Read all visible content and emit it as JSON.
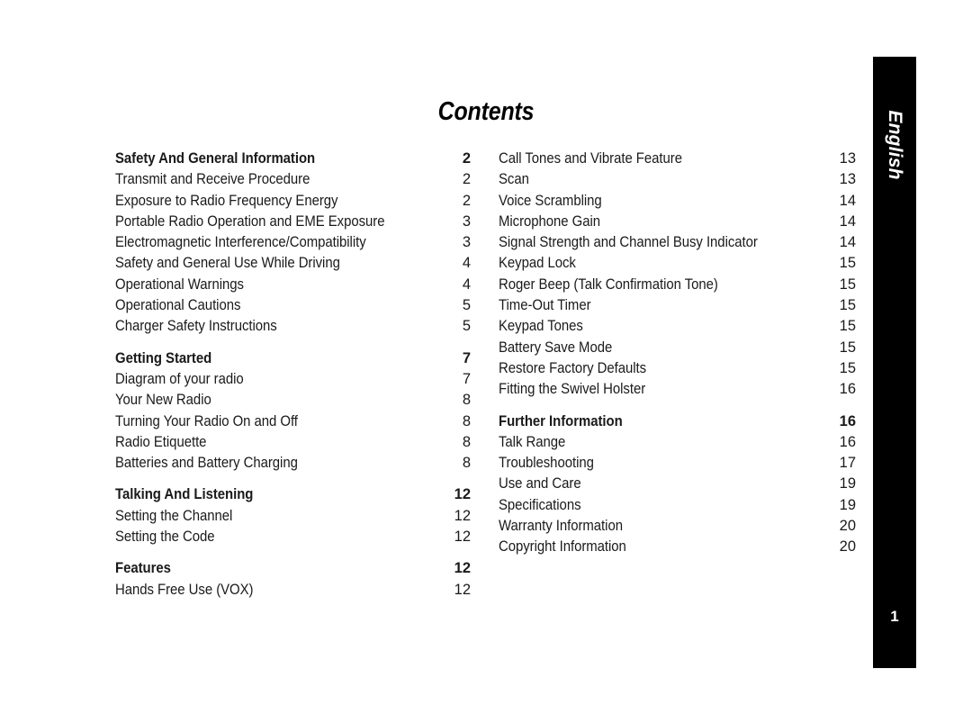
{
  "page": {
    "title": "Contents",
    "number": "1",
    "language_tab": "English"
  },
  "toc": {
    "left_column": [
      {
        "label": "Safety And General Information",
        "page": "2",
        "type": "section"
      },
      {
        "label": "Transmit and Receive Procedure",
        "page": "2",
        "type": "entry"
      },
      {
        "label": "Exposure to Radio Frequency Energy",
        "page": "2",
        "type": "entry"
      },
      {
        "label": "Portable Radio Operation and EME Exposure",
        "page": "3",
        "type": "entry"
      },
      {
        "label": "Electromagnetic Interference/Compatibility",
        "page": "3",
        "type": "entry"
      },
      {
        "label": "Safety and General Use While Driving",
        "page": "4",
        "type": "entry"
      },
      {
        "label": "Operational Warnings",
        "page": "4",
        "type": "entry"
      },
      {
        "label": "Operational Cautions",
        "page": "5",
        "type": "entry"
      },
      {
        "label": "Charger Safety Instructions",
        "page": "5",
        "type": "entry"
      },
      {
        "label": "",
        "page": "",
        "type": "spacer"
      },
      {
        "label": "Getting Started",
        "page": "7",
        "type": "section"
      },
      {
        "label": "Diagram of your radio",
        "page": "7",
        "type": "entry"
      },
      {
        "label": "Your New Radio",
        "page": "8",
        "type": "entry"
      },
      {
        "label": "Turning Your Radio On and Off",
        "page": "8",
        "type": "entry"
      },
      {
        "label": "Radio Etiquette",
        "page": "8",
        "type": "entry"
      },
      {
        "label": "Batteries and Battery Charging",
        "page": "8",
        "type": "entry"
      },
      {
        "label": "",
        "page": "",
        "type": "spacer"
      },
      {
        "label": "Talking And Listening",
        "page": "12",
        "type": "section"
      },
      {
        "label": "Setting the Channel",
        "page": "12",
        "type": "entry"
      },
      {
        "label": "Setting the Code",
        "page": "12",
        "type": "entry"
      },
      {
        "label": "",
        "page": "",
        "type": "spacer"
      },
      {
        "label": "Features",
        "page": "12",
        "type": "section"
      },
      {
        "label": "Hands Free Use (VOX)",
        "page": "12",
        "type": "entry"
      }
    ],
    "right_column": [
      {
        "label": "Call Tones and Vibrate Feature",
        "page": "13",
        "type": "entry"
      },
      {
        "label": "Scan",
        "page": "13",
        "type": "entry"
      },
      {
        "label": "Voice Scrambling",
        "page": "14",
        "type": "entry"
      },
      {
        "label": "Microphone Gain",
        "page": "14",
        "type": "entry"
      },
      {
        "label": "Signal Strength and Channel Busy Indicator",
        "page": "14",
        "type": "entry"
      },
      {
        "label": "Keypad Lock",
        "page": "15",
        "type": "entry"
      },
      {
        "label": "Roger Beep (Talk Confirmation Tone)",
        "page": "15",
        "type": "entry"
      },
      {
        "label": "Time-Out Timer",
        "page": "15",
        "type": "entry"
      },
      {
        "label": "Keypad Tones",
        "page": "15",
        "type": "entry"
      },
      {
        "label": "Battery Save Mode",
        "page": "15",
        "type": "entry"
      },
      {
        "label": "Restore Factory Defaults",
        "page": "15",
        "type": "entry"
      },
      {
        "label": "Fitting the Swivel Holster",
        "page": "16",
        "type": "entry"
      },
      {
        "label": "",
        "page": "",
        "type": "spacer"
      },
      {
        "label": "Further Information",
        "page": "16",
        "type": "section"
      },
      {
        "label": "Talk Range",
        "page": "16",
        "type": "entry"
      },
      {
        "label": "Troubleshooting",
        "page": "17",
        "type": "entry"
      },
      {
        "label": "Use and Care",
        "page": "19",
        "type": "entry"
      },
      {
        "label": "Specifications",
        "page": "19",
        "type": "entry"
      },
      {
        "label": "Warranty Information",
        "page": "20",
        "type": "entry"
      },
      {
        "label": "Copyright Information",
        "page": "20",
        "type": "entry"
      }
    ]
  },
  "colors": {
    "text": "#1a1a1a",
    "tab_background": "#000000",
    "tab_text": "#ffffff",
    "page_background": "#ffffff"
  }
}
